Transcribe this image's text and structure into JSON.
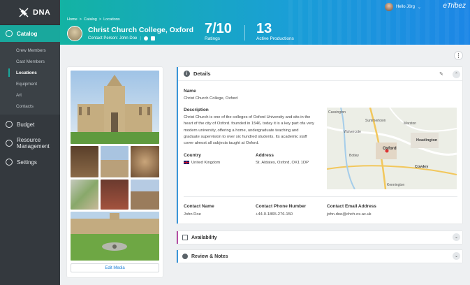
{
  "app": {
    "name": "DNA",
    "brand": "eTribez"
  },
  "sidebar": {
    "catalog_label": "Catalog",
    "catalog_items": [
      "Crew Members",
      "Cast Members",
      "Locations",
      "Equipment",
      "Art",
      "Contacts"
    ],
    "budget_label": "Budget",
    "resource_label_1": "Resource",
    "resource_label_2": "Management",
    "settings_label": "Settings"
  },
  "header": {
    "breadcrumb": [
      "Home",
      ">",
      "Catalog",
      ">",
      "Locations"
    ],
    "title": "Christ Church College, Oxford",
    "contact": "Contact Person: John Doe",
    "ratings_value": "7/10",
    "ratings_label": "Ratings",
    "productions_value": "13",
    "productions_label": "Active Productions",
    "user_greeting": "Hello Jörg"
  },
  "media": {
    "edit_label": "Edit Media"
  },
  "details": {
    "title": "Details",
    "name_label": "Name",
    "name_value": "Christ Church College, Oxford",
    "description_label": "Description",
    "description_lines": [
      "Christ Church is one of the colleges of Oxford University and sits in the",
      "heart of the city of Oxford. founded in 1546, today it is a key part ofa very",
      "modern university, offering a home, undergraduate teaching and",
      "graduate supervision to over six hundred students. Its academic staff",
      "cover almost all subjects taught at Oxford."
    ],
    "country_label": "Country",
    "country_value": "United Kingdom",
    "address_label": "Address",
    "address_value": "St. Aldates, Oxford, OX1 1DP",
    "contact_name_label": "Contact Name",
    "contact_name_value": "John Doe",
    "contact_phone_label": "Contact Phone Number",
    "contact_phone_value": "+44-0-1865-276-150",
    "contact_email_label": "Contact Email Address",
    "contact_email_value": "john.doe@chch.ox.ac.uk",
    "map_labels": [
      "Cassington",
      "Summertown",
      "Marston",
      "Headington",
      "Oxford",
      "Cowley",
      "Botley",
      "Wolvercote",
      "Kennington"
    ]
  },
  "panels": {
    "availability": "Availability",
    "review": "Review & Notes"
  },
  "colors": {
    "accent": "#19a89d",
    "header_start": "#13b3a3",
    "header_end": "#1c86e6",
    "details_border": "#3a96d9",
    "availability_border": "#b44ea3"
  }
}
